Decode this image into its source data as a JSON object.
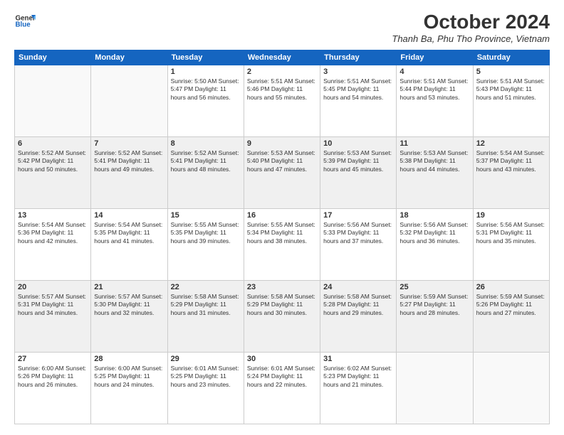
{
  "logo": {
    "line1": "General",
    "line2": "Blue"
  },
  "title": "October 2024",
  "subtitle": "Thanh Ba, Phu Tho Province, Vietnam",
  "days_of_week": [
    "Sunday",
    "Monday",
    "Tuesday",
    "Wednesday",
    "Thursday",
    "Friday",
    "Saturday"
  ],
  "weeks": [
    {
      "shaded": false,
      "days": [
        {
          "num": "",
          "info": ""
        },
        {
          "num": "",
          "info": ""
        },
        {
          "num": "1",
          "info": "Sunrise: 5:50 AM\nSunset: 5:47 PM\nDaylight: 11 hours and 56 minutes."
        },
        {
          "num": "2",
          "info": "Sunrise: 5:51 AM\nSunset: 5:46 PM\nDaylight: 11 hours and 55 minutes."
        },
        {
          "num": "3",
          "info": "Sunrise: 5:51 AM\nSunset: 5:45 PM\nDaylight: 11 hours and 54 minutes."
        },
        {
          "num": "4",
          "info": "Sunrise: 5:51 AM\nSunset: 5:44 PM\nDaylight: 11 hours and 53 minutes."
        },
        {
          "num": "5",
          "info": "Sunrise: 5:51 AM\nSunset: 5:43 PM\nDaylight: 11 hours and 51 minutes."
        }
      ]
    },
    {
      "shaded": true,
      "days": [
        {
          "num": "6",
          "info": "Sunrise: 5:52 AM\nSunset: 5:42 PM\nDaylight: 11 hours and 50 minutes."
        },
        {
          "num": "7",
          "info": "Sunrise: 5:52 AM\nSunset: 5:41 PM\nDaylight: 11 hours and 49 minutes."
        },
        {
          "num": "8",
          "info": "Sunrise: 5:52 AM\nSunset: 5:41 PM\nDaylight: 11 hours and 48 minutes."
        },
        {
          "num": "9",
          "info": "Sunrise: 5:53 AM\nSunset: 5:40 PM\nDaylight: 11 hours and 47 minutes."
        },
        {
          "num": "10",
          "info": "Sunrise: 5:53 AM\nSunset: 5:39 PM\nDaylight: 11 hours and 45 minutes."
        },
        {
          "num": "11",
          "info": "Sunrise: 5:53 AM\nSunset: 5:38 PM\nDaylight: 11 hours and 44 minutes."
        },
        {
          "num": "12",
          "info": "Sunrise: 5:54 AM\nSunset: 5:37 PM\nDaylight: 11 hours and 43 minutes."
        }
      ]
    },
    {
      "shaded": false,
      "days": [
        {
          "num": "13",
          "info": "Sunrise: 5:54 AM\nSunset: 5:36 PM\nDaylight: 11 hours and 42 minutes."
        },
        {
          "num": "14",
          "info": "Sunrise: 5:54 AM\nSunset: 5:35 PM\nDaylight: 11 hours and 41 minutes."
        },
        {
          "num": "15",
          "info": "Sunrise: 5:55 AM\nSunset: 5:35 PM\nDaylight: 11 hours and 39 minutes."
        },
        {
          "num": "16",
          "info": "Sunrise: 5:55 AM\nSunset: 5:34 PM\nDaylight: 11 hours and 38 minutes."
        },
        {
          "num": "17",
          "info": "Sunrise: 5:56 AM\nSunset: 5:33 PM\nDaylight: 11 hours and 37 minutes."
        },
        {
          "num": "18",
          "info": "Sunrise: 5:56 AM\nSunset: 5:32 PM\nDaylight: 11 hours and 36 minutes."
        },
        {
          "num": "19",
          "info": "Sunrise: 5:56 AM\nSunset: 5:31 PM\nDaylight: 11 hours and 35 minutes."
        }
      ]
    },
    {
      "shaded": true,
      "days": [
        {
          "num": "20",
          "info": "Sunrise: 5:57 AM\nSunset: 5:31 PM\nDaylight: 11 hours and 34 minutes."
        },
        {
          "num": "21",
          "info": "Sunrise: 5:57 AM\nSunset: 5:30 PM\nDaylight: 11 hours and 32 minutes."
        },
        {
          "num": "22",
          "info": "Sunrise: 5:58 AM\nSunset: 5:29 PM\nDaylight: 11 hours and 31 minutes."
        },
        {
          "num": "23",
          "info": "Sunrise: 5:58 AM\nSunset: 5:29 PM\nDaylight: 11 hours and 30 minutes."
        },
        {
          "num": "24",
          "info": "Sunrise: 5:58 AM\nSunset: 5:28 PM\nDaylight: 11 hours and 29 minutes."
        },
        {
          "num": "25",
          "info": "Sunrise: 5:59 AM\nSunset: 5:27 PM\nDaylight: 11 hours and 28 minutes."
        },
        {
          "num": "26",
          "info": "Sunrise: 5:59 AM\nSunset: 5:26 PM\nDaylight: 11 hours and 27 minutes."
        }
      ]
    },
    {
      "shaded": false,
      "days": [
        {
          "num": "27",
          "info": "Sunrise: 6:00 AM\nSunset: 5:26 PM\nDaylight: 11 hours and 26 minutes."
        },
        {
          "num": "28",
          "info": "Sunrise: 6:00 AM\nSunset: 5:25 PM\nDaylight: 11 hours and 24 minutes."
        },
        {
          "num": "29",
          "info": "Sunrise: 6:01 AM\nSunset: 5:25 PM\nDaylight: 11 hours and 23 minutes."
        },
        {
          "num": "30",
          "info": "Sunrise: 6:01 AM\nSunset: 5:24 PM\nDaylight: 11 hours and 22 minutes."
        },
        {
          "num": "31",
          "info": "Sunrise: 6:02 AM\nSunset: 5:23 PM\nDaylight: 11 hours and 21 minutes."
        },
        {
          "num": "",
          "info": ""
        },
        {
          "num": "",
          "info": ""
        }
      ]
    }
  ]
}
